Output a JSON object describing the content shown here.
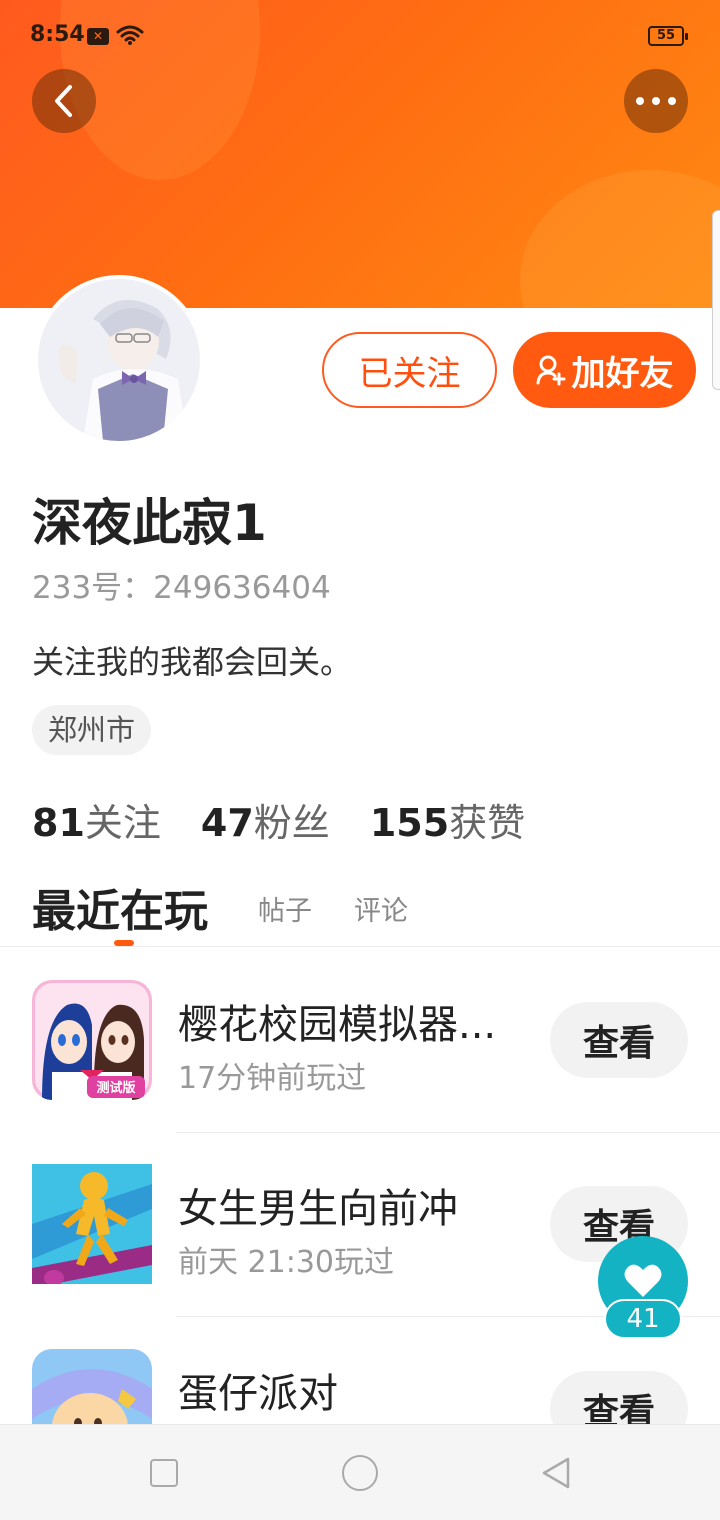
{
  "status_bar": {
    "time": "8:54",
    "sim_label": "✕",
    "battery": "55",
    "icons": [
      "notification-icon",
      "wifi-icon",
      "battery-icon"
    ]
  },
  "header": {
    "back_icon": "chevron-left-icon",
    "more_icon": "more-dots-icon",
    "accent_color": "#ff5a10"
  },
  "profile": {
    "username": "深夜此寂1",
    "uid": "233号：249636404",
    "bio": "关注我的我都会回关。",
    "location": "郑州市",
    "follow_label": "已关注",
    "add_friend_label": "加好友",
    "add_friend_icon": "add-user-icon"
  },
  "stats": [
    {
      "num": "81",
      "label": "关注"
    },
    {
      "num": "47",
      "label": "粉丝"
    },
    {
      "num": "155",
      "label": "获赞"
    }
  ],
  "tabs": {
    "active": "最近在玩",
    "posts": "帖子",
    "comments": "评论"
  },
  "games": [
    {
      "title": "樱花校园模拟器...",
      "time": "17分钟前玩过",
      "action": "查看",
      "badge": "测试版"
    },
    {
      "title": "女生男生向前冲",
      "time": "前天 21:30玩过",
      "action": "查看"
    },
    {
      "title": "蛋仔派对",
      "time": "",
      "action": "查看"
    }
  ],
  "like_float": {
    "count": "41",
    "icon": "heart-icon",
    "color": "#14b3c4"
  },
  "nav_bar": {
    "icons": [
      "recent-apps-icon",
      "home-icon",
      "back-icon"
    ]
  }
}
